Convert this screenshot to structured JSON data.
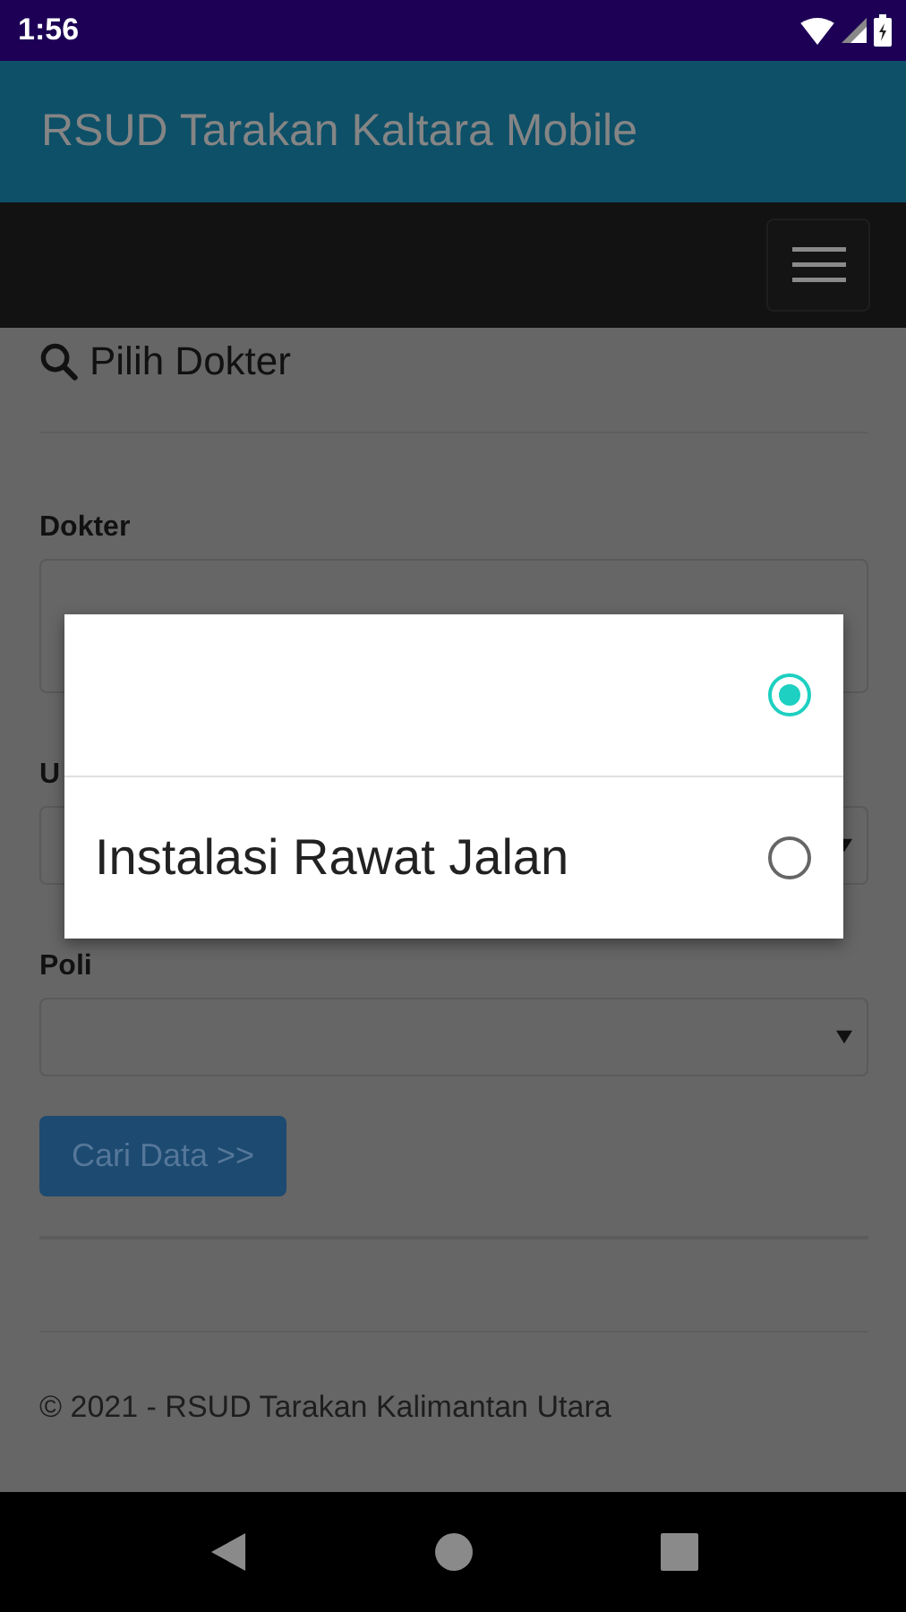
{
  "status_bar": {
    "time": "1:56"
  },
  "app_bar": {
    "title": "RSUD Tarakan Kaltara Mobile"
  },
  "form": {
    "heading": "Pilih Dokter",
    "fields": [
      {
        "kind": "text",
        "label": "Dokter"
      },
      {
        "kind": "select",
        "label": "U"
      },
      {
        "kind": "select",
        "label": "Poli"
      }
    ],
    "submit": "Cari Data >>"
  },
  "footer": "© 2021 - RSUD Tarakan Kalimantan Utara",
  "dialog": {
    "options": [
      {
        "selected": true
      },
      {
        "label": "Instalasi Rawat Jalan",
        "selected": false
      }
    ]
  }
}
